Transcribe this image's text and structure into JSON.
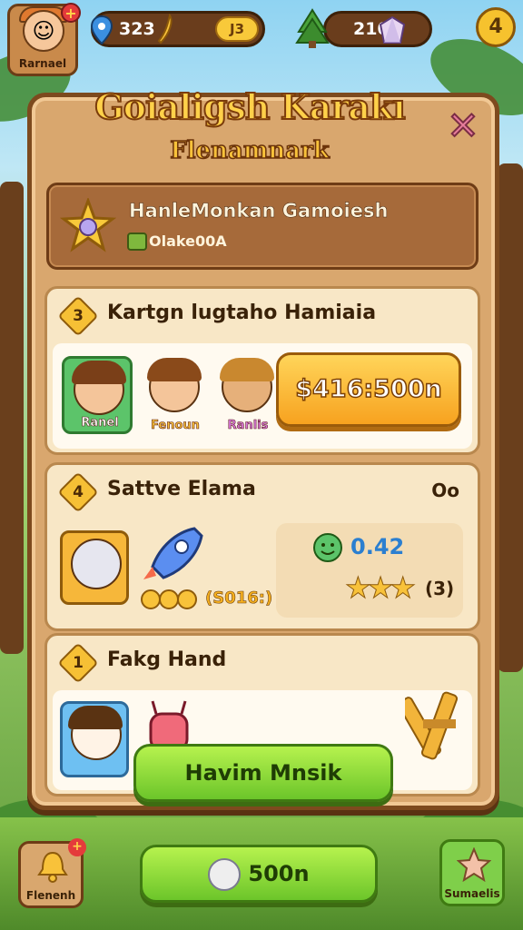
{
  "hud": {
    "player_name": "Rarnael",
    "location_value": "323",
    "gold_badge": "J3",
    "gem_value": "210",
    "top_right_badge": "4"
  },
  "panel": {
    "title": "Goialigsh Karakı",
    "subtitle": "Flenamnark",
    "close_glyph": "✕",
    "mission": {
      "title": "HanleMonkan Gamoiesh",
      "subtitle": "Olake00A"
    },
    "sections": [
      {
        "number": "3",
        "title": "Kartgn lugtaho Hamiaia",
        "characters": [
          {
            "label": "Ranel",
            "color": "#5cc46a"
          },
          {
            "label": "Fenoun",
            "color": "#f8e7c6"
          },
          {
            "label": "Ranlis",
            "color": "#f8e7c6"
          }
        ],
        "price_label": "$416:500n"
      },
      {
        "number": "4",
        "title": "Sattve Elama",
        "right_text": "Oo",
        "reward_count": "(S016:)",
        "timer_value": "0.42",
        "stars_label": "(3)",
        "stars_rating": 3
      },
      {
        "number": "1",
        "title": "Fakg Hand"
      }
    ],
    "main_button_label": "Havim Mnsik"
  },
  "bottom": {
    "left_label": "Flenenh",
    "center_button_label": "500n",
    "right_label": "Sumaelis"
  },
  "colors": {
    "panel": "#d9a76e",
    "panel_border": "#7d4a1e",
    "accent_gold": "#ffd14a",
    "green_button": "#6cc52a",
    "orange_button": "#f7a21f"
  }
}
